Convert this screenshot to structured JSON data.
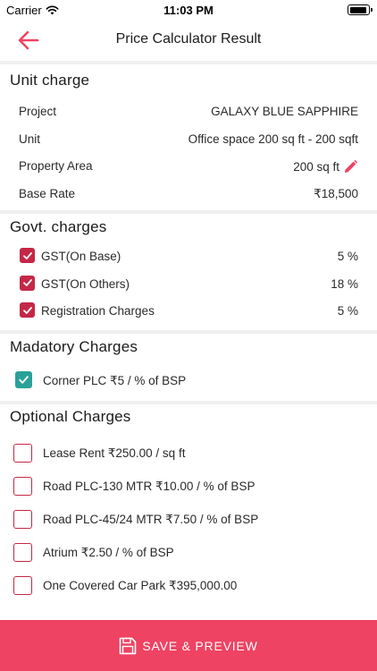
{
  "status_bar": {
    "carrier": "Carrier",
    "time": "11:03 PM"
  },
  "nav": {
    "title": "Price Calculator Result"
  },
  "unit_charge": {
    "heading": "Unit charge",
    "rows": [
      {
        "label": "Project",
        "value": "GALAXY BLUE SAPPHIRE"
      },
      {
        "label": "Unit",
        "value": "Office space 200 sq ft - 200 sqft"
      },
      {
        "label": "Property Area",
        "value": "200 sq ft"
      },
      {
        "label": "Base Rate",
        "value": "₹18,500"
      }
    ]
  },
  "govt_charges": {
    "heading": "Govt. charges",
    "rows": [
      {
        "label": "GST(On Base)",
        "value": "5 %",
        "checked": true
      },
      {
        "label": "GST(On Others)",
        "value": "18 %",
        "checked": true
      },
      {
        "label": "Registration Charges",
        "value": "5 %",
        "checked": true
      }
    ]
  },
  "mandatory_charges": {
    "heading": "Madatory Charges",
    "rows": [
      {
        "label": "Corner PLC ₹5 / % of BSP",
        "checked": true
      }
    ]
  },
  "optional_charges": {
    "heading": "Optional Charges",
    "rows": [
      {
        "label": "Lease Rent ₹250.00 / sq ft",
        "checked": false
      },
      {
        "label": "Road PLC-130 MTR ₹10.00 / % of BSP",
        "checked": false
      },
      {
        "label": "Road PLC-45/24 MTR ₹7.50 / % of BSP",
        "checked": false
      },
      {
        "label": "Atrium ₹2.50 / % of BSP",
        "checked": false
      },
      {
        "label": "One Covered Car Park ₹395,000.00",
        "checked": false
      }
    ]
  },
  "footer": {
    "save_label": "SAVE & PREVIEW"
  },
  "colors": {
    "accent": "#ee4363",
    "checkbox_red": "#c42846",
    "checkbox_teal": "#2aa198"
  }
}
